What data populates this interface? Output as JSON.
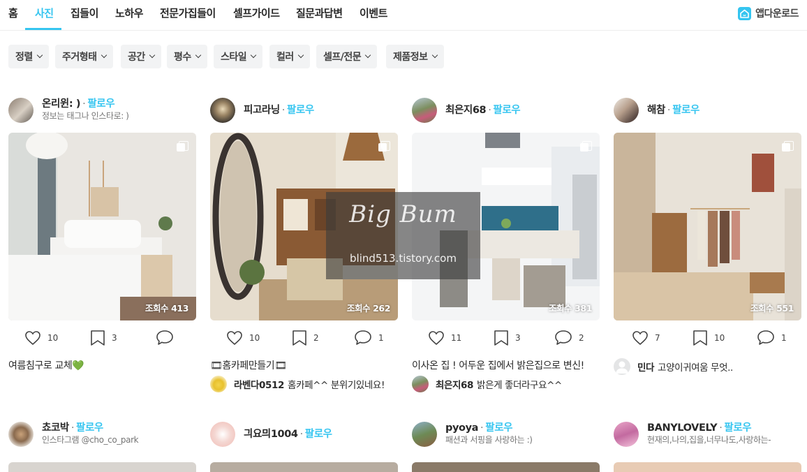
{
  "nav": {
    "tabs": [
      "홈",
      "사진",
      "집들이",
      "노하우",
      "전문가집들이",
      "셀프가이드",
      "질문과답변",
      "이벤트"
    ],
    "active": "사진",
    "app_download": "앱다운로드"
  },
  "filters": [
    "정렬",
    "주거형태",
    "공간",
    "평수",
    "스타일",
    "컬러",
    "셀프/전문",
    "제품정보"
  ],
  "cards": [
    {
      "author": "온리윈: )",
      "follow": "팔로우",
      "bio": "정보는 태그나 인스타로: )",
      "views": "조회수 413",
      "likes": "10",
      "scraps": "3",
      "comments": "",
      "description": "여름침구로 교체💚",
      "comment_author": "",
      "comment_text": ""
    },
    {
      "author": "피고라닝",
      "follow": "팔로우",
      "bio": "",
      "views": "조회수 262",
      "likes": "10",
      "scraps": "2",
      "comments": "1",
      "description": "🎞홈카페만들기🎞",
      "comment_author": "라벤다0512",
      "comment_text": "홈카페^^ 분위기있네요!"
    },
    {
      "author": "최은지68",
      "follow": "팔로우",
      "bio": "",
      "views": "조회수 381",
      "likes": "11",
      "scraps": "3",
      "comments": "2",
      "description": "이사온 집 ! 어두운 집에서 밝은집으로 변신!",
      "comment_author": "최은지68",
      "comment_text": "밝은게 좋더라구요^^"
    },
    {
      "author": "해참",
      "follow": "팔로우",
      "bio": "",
      "views": "조회수 551",
      "likes": "7",
      "scraps": "10",
      "comments": "1",
      "description": "",
      "comment_author": "민다",
      "comment_text": "고양이귀여움 무엇.."
    }
  ],
  "cards_row2": [
    {
      "author": "쵸코박",
      "follow": "팔로우",
      "bio": "인스타그램 @cho_co_park"
    },
    {
      "author": "긔요믜1004",
      "follow": "팔로우",
      "bio": ""
    },
    {
      "author": "pyoya",
      "follow": "팔로우",
      "bio": "패션과 서핑을 사랑하는 :)"
    },
    {
      "author": "BANYLOVELY",
      "follow": "팔로우",
      "bio": "현재의,나의,집을,너무나도,사랑하는-"
    }
  ],
  "watermark": {
    "logo": "Big Bum",
    "url": "blind513.tistory.com"
  },
  "colors": {
    "accent": "#35c5f0",
    "text": "#292929",
    "muted": "#757575",
    "filter_bg": "#f2f3f4"
  }
}
